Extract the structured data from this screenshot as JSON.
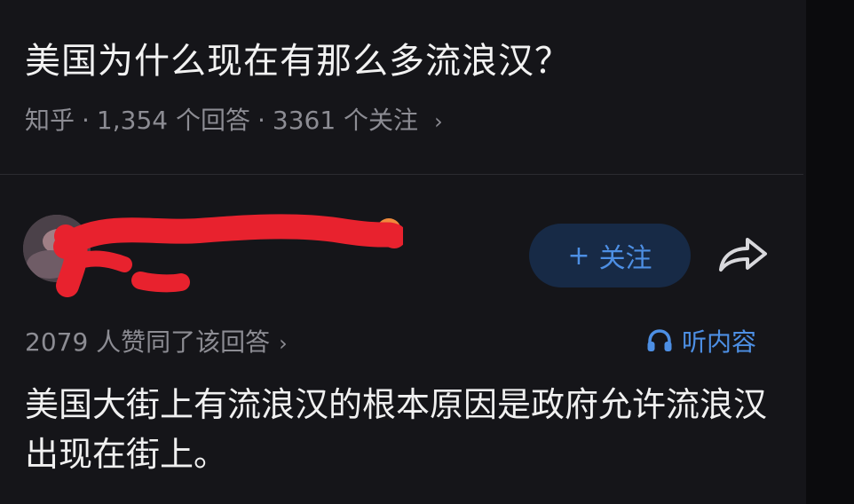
{
  "question": {
    "title": "美国为什么现在有那么多流浪汉？",
    "source": "知乎",
    "answers_count": "1,354 个回答",
    "followers_count": "3361 个关注",
    "separator": "·",
    "chevron": "›"
  },
  "answer": {
    "follow_label": "关注",
    "follow_plus": "+",
    "agree_text": "2079 人赞同了该回答",
    "chevron": "›",
    "listen_label": "听内容",
    "text": "美国大街上有流浪汉的根本原因是政府允许流浪汉出现在街上。"
  },
  "colors": {
    "background": "#151519",
    "accent_blue": "#4d8fe4",
    "redaction_red": "#e8222e"
  },
  "icons": [
    "chevron-right-icon",
    "plus-icon",
    "share-icon",
    "headphones-icon"
  ]
}
